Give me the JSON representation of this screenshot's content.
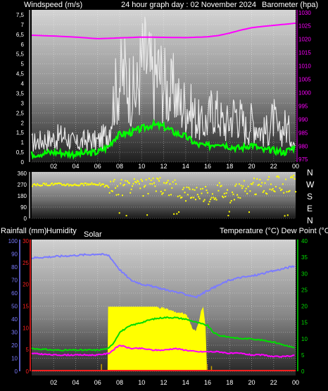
{
  "header": {
    "wind_title": "Windspeed (m/s)",
    "center_title": "24 hour graph day : 02 November 2024",
    "baro_title": "Barometer (hpa)"
  },
  "mid_labels": {
    "left_rain": "Rainfall (mm)",
    "left_humidity": "Humidity",
    "solar": "Solar",
    "right": "Temperature (°C) Dew Point (°C)"
  },
  "compass": [
    "N",
    "W",
    "S",
    "E",
    "N"
  ],
  "colors": {
    "wind_gust": "#e8e8e8",
    "wind_avg": "#00ff00",
    "barometer": "#ff00ff",
    "wind_dir": "#ffff00",
    "humidity": "#7b7bff",
    "temperature": "#00dd00",
    "dewpoint": "#ff00ff",
    "solar": "#ffff00",
    "rain": "#ff2020",
    "axis_wind": "#ffffff",
    "axis_baro": "#ff00ff",
    "axis_rain": "#ff2020",
    "axis_humidity": "#7b7bff",
    "axis_temp": "#00dd00"
  },
  "chart_data": [
    {
      "type": "line",
      "title": "24 hour graph day : 02 November 2024",
      "x_ticks": [
        "02",
        "04",
        "06",
        "08",
        "10",
        "12",
        "14",
        "16",
        "18",
        "20",
        "22",
        "00"
      ],
      "y_left": {
        "label": "Windspeed (m/s)",
        "ticks": [
          "0",
          "0,5",
          "1",
          "1,5",
          "2",
          "2,5",
          "3",
          "3,5",
          "4",
          "4,5",
          "5",
          "5,5",
          "6",
          "6,5",
          "7",
          "7,5"
        ],
        "ylim": [
          0,
          7.75
        ]
      },
      "y_right": {
        "label": "Barometer (hpa)",
        "ticks": [
          "975",
          "980",
          "985",
          "990",
          "995",
          "1000",
          "1005",
          "1010",
          "1015",
          "1020",
          "1025",
          "1030"
        ],
        "ylim": [
          974,
          1031
        ]
      },
      "series": [
        {
          "name": "Barometer (hpa)",
          "hours": [
            0,
            2,
            4,
            6,
            8,
            10,
            12,
            14,
            16,
            17,
            18,
            19,
            20,
            21,
            22,
            23,
            24
          ],
          "values": [
            1021.5,
            1021.2,
            1020.8,
            1020.2,
            1020.5,
            1020.8,
            1020.7,
            1020.6,
            1020.9,
            1021.4,
            1022.3,
            1023.4,
            1024.3,
            1024.8,
            1025.2,
            1025.6,
            1026
          ]
        },
        {
          "name": "Windspeed (m/s)",
          "hours": [
            0,
            2,
            4,
            6,
            7,
            7.5,
            8,
            9,
            10,
            11,
            12,
            13,
            14,
            15,
            16,
            17,
            18,
            19,
            20,
            21,
            22,
            23,
            24
          ],
          "values": [
            0.4,
            0.5,
            0.4,
            0.5,
            0.8,
            1.2,
            1.4,
            1.5,
            1.7,
            1.9,
            1.8,
            1.5,
            1.3,
            0.9,
            0.8,
            1.0,
            0.8,
            0.7,
            0.9,
            0.6,
            0.6,
            0.5,
            0.8
          ]
        },
        {
          "hours": [
            0,
            1,
            2,
            3,
            4,
            5,
            6,
            7,
            7.5,
            8,
            8.5,
            9,
            9.5,
            10,
            10.5,
            11,
            11.5,
            12,
            12.5,
            13,
            13.5,
            14,
            14.5,
            15,
            15.5,
            16,
            16.5,
            17,
            17.5,
            18,
            18.5,
            19,
            19.5,
            20,
            20.5,
            21,
            21.5,
            22,
            22.5,
            23,
            23.5,
            24
          ],
          "values": [
            1.3,
            1.5,
            1.6,
            1.8,
            1.2,
            1.5,
            1.4,
            2.0,
            4.5,
            5.5,
            6.0,
            5.0,
            4.5,
            6.8,
            7.0,
            5.5,
            6.2,
            5.5,
            4.5,
            5.0,
            3.8,
            4.0,
            3.5,
            3.0,
            2.5,
            2.8,
            3.8,
            3.2,
            2.5,
            2.8,
            3.5,
            3.0,
            2.2,
            2.8,
            2.5,
            2.0,
            2.2,
            3.0,
            1.8,
            2.5,
            2.0,
            1.0
          ]
        }
      ]
    },
    {
      "type": "scatter",
      "x_ticks": [
        "02",
        "04",
        "06",
        "08",
        "10",
        "12",
        "14",
        "16",
        "18",
        "20",
        "22",
        "00"
      ],
      "y_ticks": [
        "0",
        "90",
        "180",
        "270",
        "360"
      ],
      "ylim": [
        0,
        360
      ],
      "series": [
        {
          "hours": [
            0,
            1,
            2,
            3,
            4,
            5,
            6,
            7,
            8,
            9,
            10,
            11,
            12,
            13,
            14,
            15,
            16,
            17,
            18,
            19,
            20,
            21,
            22,
            23,
            24
          ],
          "values": [
            265,
            270,
            275,
            270,
            268,
            272,
            275,
            250,
            240,
            250,
            245,
            260,
            255,
            240,
            200,
            215,
            180,
            230,
            185,
            230,
            250,
            260,
            270,
            265,
            280
          ]
        }
      ]
    },
    {
      "type": "line",
      "x_ticks": [
        "02",
        "04",
        "06",
        "08",
        "10",
        "12",
        "14",
        "16",
        "18",
        "20",
        "22",
        "00"
      ],
      "y_rain": {
        "label": "Rainfall (mm)",
        "ticks": [
          "0",
          "5",
          "10",
          "15",
          "20",
          "25",
          "30"
        ],
        "ylim": [
          0,
          30
        ]
      },
      "y_humidity": {
        "label": "Humidity",
        "ticks": [
          "0",
          "10",
          "20",
          "30",
          "40",
          "50",
          "60",
          "70",
          "80",
          "90",
          "100"
        ],
        "ylim": [
          0,
          100
        ]
      },
      "y_temp": {
        "label": "Temperature (°C) Dew Point (°C)",
        "ticks": [
          "0",
          "5",
          "10",
          "15",
          "20",
          "25",
          "30",
          "35",
          "40"
        ],
        "ylim": [
          0,
          40
        ]
      },
      "series": [
        {
          "name": "Humidity",
          "hours": [
            0,
            2,
            4,
            6,
            7,
            8,
            9,
            10,
            11,
            12,
            13,
            14,
            15,
            16,
            17,
            18,
            19,
            20,
            21,
            22,
            23,
            24
          ],
          "values": [
            87,
            88,
            89,
            90,
            89,
            78,
            70,
            67,
            65,
            63,
            61,
            59,
            57,
            62,
            66,
            70,
            72,
            73,
            75,
            77,
            79,
            81
          ]
        },
        {
          "name": "Temperature (°C)",
          "hours": [
            0,
            2,
            4,
            6,
            7,
            7.5,
            8,
            9,
            10,
            11,
            12,
            13,
            14,
            15,
            16,
            16.5,
            17,
            18,
            19,
            20,
            21,
            22,
            23,
            24
          ],
          "values": [
            7,
            6.5,
            6.5,
            6.5,
            7,
            9,
            12,
            14,
            15,
            16,
            16.5,
            16.5,
            16,
            15,
            14,
            12,
            11,
            10.5,
            10,
            10,
            9.5,
            9,
            8,
            7
          ]
        },
        {
          "name": "Dew Point (°C)",
          "hours": [
            0,
            2,
            4,
            6,
            7,
            8,
            9,
            10,
            11,
            12,
            13,
            14,
            15,
            16,
            17,
            18,
            19,
            20,
            21,
            22,
            23,
            24
          ],
          "values": [
            5.5,
            5,
            5,
            5,
            5.5,
            8,
            7,
            7,
            6.5,
            6.5,
            7,
            6.5,
            6,
            6,
            6,
            5.5,
            5.5,
            5,
            5,
            4.5,
            4.5,
            5
          ]
        },
        {
          "name": "Solar",
          "hours": [
            6.9,
            6.95,
            7,
            12,
            13,
            14,
            14.3,
            14.6,
            14.9,
            15.2,
            15.4,
            15.6,
            15.8,
            15.9,
            15.95,
            16
          ],
          "values": [
            0,
            19.8,
            19.8,
            19.8,
            18.5,
            18,
            16.5,
            13.5,
            12.5,
            15,
            18.5,
            19.8,
            14,
            5,
            0,
            0
          ]
        },
        {
          "name": "Rainfall (mm)",
          "hours": [
            0,
            24
          ],
          "values": [
            0,
            0
          ]
        }
      ]
    }
  ]
}
